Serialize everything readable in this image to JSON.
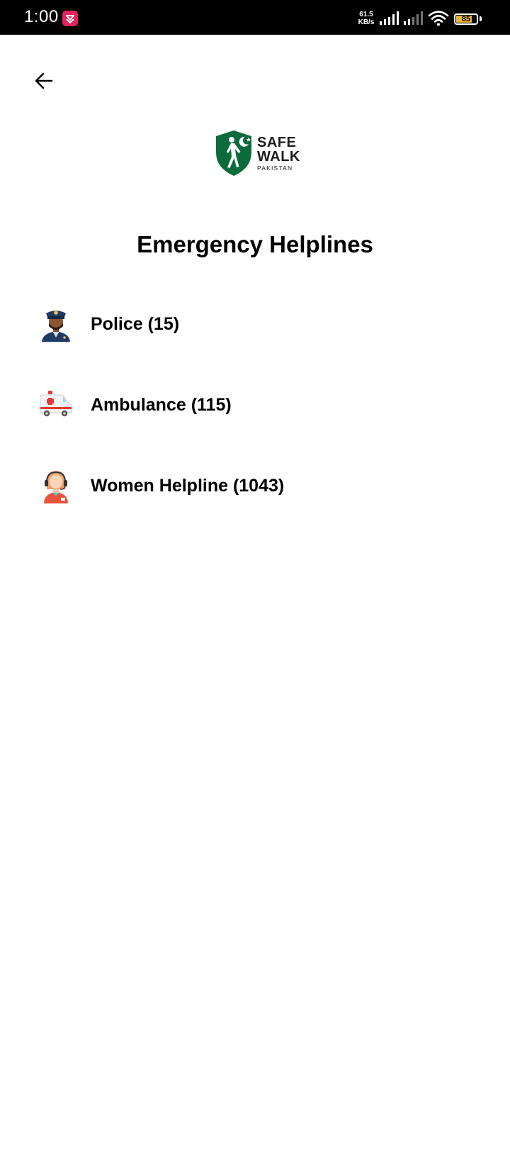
{
  "status_bar": {
    "time": "1:00",
    "net_speed_value": "61.5",
    "net_speed_unit": "KB/s",
    "battery_level": "85",
    "battery_percent": 85
  },
  "logo": {
    "line1": "SAFE",
    "line2": "WALK",
    "line3": "PAKISTAN",
    "brand_color": "#0b6b3a"
  },
  "page": {
    "title": "Emergency Helplines"
  },
  "helplines": [
    {
      "icon": "police-officer-icon",
      "label": "Police (15)"
    },
    {
      "icon": "ambulance-icon",
      "label": "Ambulance (115)"
    },
    {
      "icon": "women-helpline-operator-icon",
      "label": "Women Helpline (1043)"
    }
  ]
}
